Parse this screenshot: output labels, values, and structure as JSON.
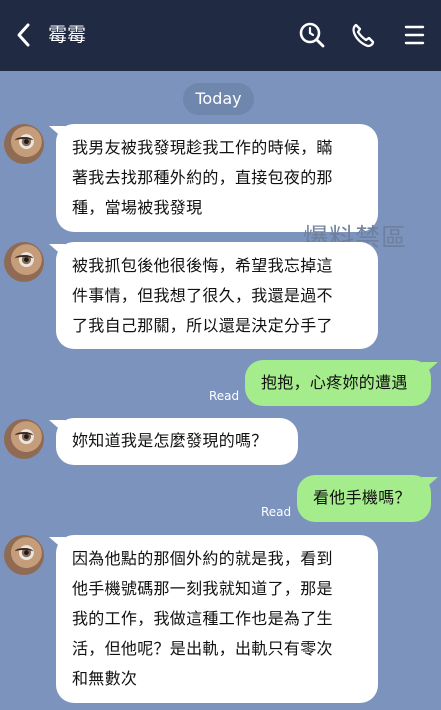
{
  "header": {
    "contact_name": "霉霉",
    "back_icon": "chevron-left-icon",
    "search_icon": "search-icon",
    "call_icon": "phone-icon",
    "menu_icon": "menu-icon"
  },
  "chat": {
    "date_label": "Today",
    "read_label": "Read",
    "watermark": "爆料禁區",
    "messages": [
      {
        "sender": "contact",
        "lines": [
          "我男友被我發現趁我工作的時候，瞞",
          "著我去找那種外約的，直接包夜的那",
          "種，當場被我發現"
        ]
      },
      {
        "sender": "contact",
        "lines": [
          "被我抓包後他很後悔，希望我忘掉這",
          "件事情，但我想了很久，我還是過不",
          "了我自己那關，所以還是決定分手了"
        ]
      },
      {
        "sender": "me",
        "lines": [
          "抱抱，心疼妳的遭遇"
        ],
        "status": "Read"
      },
      {
        "sender": "contact",
        "lines": [
          "妳知道我是怎麼發現的嗎？"
        ]
      },
      {
        "sender": "me",
        "lines": [
          "看他手機嗎？"
        ],
        "status": "Read"
      },
      {
        "sender": "contact",
        "lines": [
          "因為他點的那個外約的就是我，看到",
          "他手機號碼那一刻我就知道了，那是",
          "我的工作，我做這種工作也是為了生",
          "活，但他呢？是出軌，出軌只有零次",
          "和無數次"
        ]
      }
    ]
  },
  "colors": {
    "header_bg": "#202a43",
    "chat_bg": "#7b93bd",
    "incoming_bubble": "#ffffff",
    "outgoing_bubble": "#a5ec8c"
  }
}
